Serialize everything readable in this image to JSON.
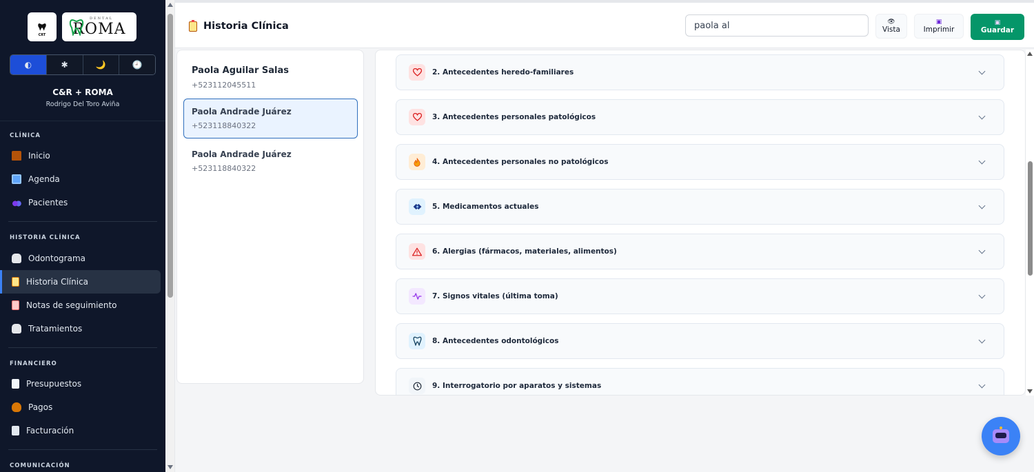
{
  "sidebar": {
    "logo_small_text": "CRT",
    "logo_big": {
      "top": "DENTAL",
      "main": "ROMA"
    },
    "theme_options": [
      {
        "icon": "contrast-icon",
        "glyph": "◐",
        "active": true
      },
      {
        "icon": "sun-icon",
        "glyph": "✱",
        "active": false
      },
      {
        "icon": "moon-icon",
        "glyph": "🌙",
        "active": false
      },
      {
        "icon": "clock-icon",
        "glyph": "🕘",
        "active": false
      }
    ],
    "org_name": "C&R + ROMA",
    "user_name": "Rodrigo Del Toro Aviña",
    "sections": {
      "clinica": "CLÍNICA",
      "historia": "HISTORIA CLÍNICA",
      "financiero": "FINANCIERO",
      "comunicacion": "COMUNICACIÓN"
    },
    "items": {
      "inicio": "Inicio",
      "agenda": "Agenda",
      "pacientes": "Pacientes",
      "odontograma": "Odontograma",
      "historia_clinica": "Historia Clínica",
      "notas": "Notas de seguimiento",
      "tratamientos": "Tratamientos",
      "presupuestos": "Presupuestos",
      "pagos": "Pagos",
      "facturacion": "Facturación"
    }
  },
  "header": {
    "title": "Historia Clínica",
    "search_value": "paola al",
    "vista_label": "Vista",
    "imprimir_label": "Imprimir",
    "guardar_label": "Guardar"
  },
  "patients": [
    {
      "name": "Paola Aguilar Salas",
      "phone": "+523112045511",
      "selected": false
    },
    {
      "name": "Paola Andrade Juárez",
      "phone": "+523118840322",
      "selected": true
    },
    {
      "name": "Paola Andrade Juárez",
      "phone": "+523118840322",
      "selected": false
    }
  ],
  "sections": [
    {
      "title": "2. Antecedentes heredo-familiares",
      "icon": "heart-icon",
      "color": "#dc2626"
    },
    {
      "title": "3. Antecedentes personales patológicos",
      "icon": "heart-icon",
      "color": "#dc2626"
    },
    {
      "title": "4. Antecedentes personales no patológicos",
      "icon": "flame-icon",
      "color": "#ea580c"
    },
    {
      "title": "5. Medicamentos actuales",
      "icon": "pill-icon",
      "color": "#1e3a8a"
    },
    {
      "title": "6. Alergias (fármacos, materiales, alimentos)",
      "icon": "warning-icon",
      "color": "#dc2626"
    },
    {
      "title": "7. Signos vitales (última toma)",
      "icon": "pulse-icon",
      "color": "#9333ea"
    },
    {
      "title": "8. Antecedentes odontológicos",
      "icon": "tooth-icon",
      "color": "#0f3d5c"
    },
    {
      "title": "9. Interrogatorio por aparatos y sistemas",
      "icon": "clock-icon",
      "color": "#1f2937"
    }
  ],
  "colors": {
    "sidebar_bg": "#0f172a",
    "accent": "#1d4ed8",
    "guardar_bg": "#059669",
    "bot_bg": "#3b82f6"
  }
}
